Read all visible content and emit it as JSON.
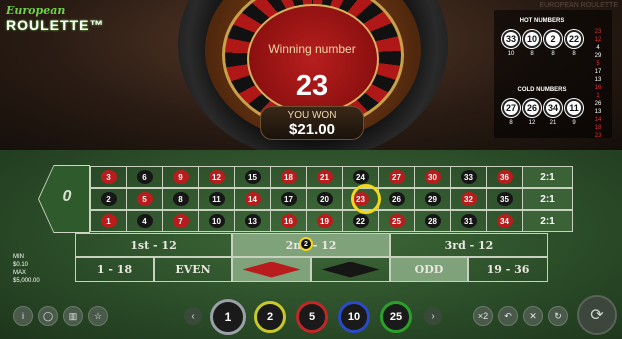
{
  "logo": {
    "line1": "European",
    "line2": "ROULETTE™"
  },
  "game_title": "EUROPEAN ROULETTE",
  "result": {
    "label": "Winning number",
    "number": "23",
    "won_label": "YOU WON",
    "won_amount": "$21.00"
  },
  "stats": {
    "hot_title": "HOT NUMBERS",
    "hot": [
      {
        "n": "33",
        "c": "10"
      },
      {
        "n": "10",
        "c": "8"
      },
      {
        "n": "2",
        "c": "8"
      },
      {
        "n": "22",
        "c": "8"
      }
    ],
    "cold_title": "COLD NUMBERS",
    "cold": [
      {
        "n": "27",
        "c": "8"
      },
      {
        "n": "26",
        "c": "12"
      },
      {
        "n": "34",
        "c": "21"
      },
      {
        "n": "11",
        "c": "9"
      }
    ],
    "history": [
      {
        "v": "23",
        "color": "#e23030"
      },
      {
        "v": "12",
        "color": "#e23030"
      },
      {
        "v": "4",
        "color": "#ffffff"
      },
      {
        "v": "29",
        "color": "#ffffff"
      },
      {
        "v": "5",
        "color": "#e23030"
      },
      {
        "v": "17",
        "color": "#ffffff"
      },
      {
        "v": "13",
        "color": "#ffffff"
      },
      {
        "v": "16",
        "color": "#e23030"
      },
      {
        "v": "1",
        "color": "#e23030"
      },
      {
        "v": "26",
        "color": "#ffffff"
      },
      {
        "v": "13",
        "color": "#ffffff"
      },
      {
        "v": "14",
        "color": "#e23030"
      },
      {
        "v": "18",
        "color": "#e23030"
      },
      {
        "v": "23",
        "color": "#e23030"
      }
    ]
  },
  "table": {
    "zero": "0",
    "rows": [
      [
        "3",
        "6",
        "9",
        "12",
        "15",
        "18",
        "21",
        "24",
        "27",
        "30",
        "33",
        "36"
      ],
      [
        "2",
        "5",
        "8",
        "11",
        "14",
        "17",
        "20",
        "23",
        "26",
        "29",
        "32",
        "35"
      ],
      [
        "1",
        "4",
        "7",
        "10",
        "13",
        "16",
        "19",
        "22",
        "25",
        "28",
        "31",
        "34"
      ]
    ],
    "red_numbers": [
      "1",
      "3",
      "5",
      "7",
      "9",
      "12",
      "14",
      "16",
      "18",
      "19",
      "21",
      "23",
      "25",
      "27",
      "30",
      "32",
      "34",
      "36"
    ],
    "columns": [
      "2:1",
      "2:1",
      "2:1"
    ],
    "dozens": [
      "1st - 12",
      "2nd - 12",
      "3rd - 12"
    ],
    "outside": [
      "1 - 18",
      "EVEN",
      "",
      "",
      "ODD",
      "19 - 36"
    ],
    "colors": {
      "red": "#b81c1c",
      "black": "#161616",
      "highlight": "#f4d61a"
    },
    "dozen_marker": "2"
  },
  "limits": {
    "min_label": "MIN",
    "min": "$0.10",
    "max_label": "MAX",
    "max": "$5,000.00"
  },
  "controls": {
    "left_icons": [
      "i",
      "◯",
      "▥",
      "☆"
    ],
    "prev": "‹",
    "next": "›",
    "chips": [
      {
        "v": "1",
        "color": "#9aa0a8"
      },
      {
        "v": "2",
        "color": "#c8c82a"
      },
      {
        "v": "5",
        "color": "#c02828"
      },
      {
        "v": "10",
        "color": "#2a4ac8"
      },
      {
        "v": "25",
        "color": "#2aa02a"
      }
    ],
    "right_icons": [
      "×2",
      "↶",
      "✕",
      "↻"
    ],
    "spin": "⟳"
  }
}
